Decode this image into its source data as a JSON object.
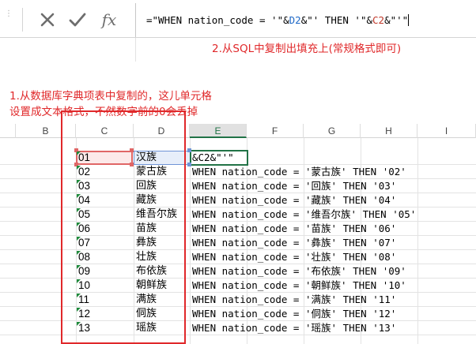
{
  "formula_bar": {
    "dots": "⋮",
    "cancel_icon": "x-icon",
    "enter_icon": "check-icon",
    "fx_label": "fx",
    "formula_prefix": "=\"WHEN nation_code = '\"&",
    "ref1": "D2",
    "formula_mid": "&\"' THEN '\"&",
    "ref2": "C2",
    "formula_suffix": "&\"'\""
  },
  "annotations": {
    "note2": "2.从SQL中复制出填充上(常规格式即可)",
    "note1_line1": "1.从数据库字典项表中复制的，这儿单元格",
    "note1_line2": "设置成文本格式，不然数字前的0会丢掉"
  },
  "columns": [
    "B",
    "C",
    "D",
    "E",
    "F",
    "G",
    "H",
    "I"
  ],
  "selected_column": "E",
  "rows": [
    {
      "c": "01",
      "d": "汉族",
      "e": "&C2&\"'\""
    },
    {
      "c": "02",
      "d": "蒙古族",
      "e": "WHEN nation_code = '蒙古族' THEN '02'"
    },
    {
      "c": "03",
      "d": "回族",
      "e": "WHEN nation_code = '回族' THEN '03'"
    },
    {
      "c": "04",
      "d": "藏族",
      "e": "WHEN nation_code = '藏族' THEN '04'"
    },
    {
      "c": "05",
      "d": "维吾尔族",
      "e": "WHEN nation_code = '维吾尔族' THEN '05'"
    },
    {
      "c": "06",
      "d": "苗族",
      "e": "WHEN nation_code = '苗族' THEN '06'"
    },
    {
      "c": "07",
      "d": "彝族",
      "e": "WHEN nation_code = '彝族' THEN '07'"
    },
    {
      "c": "08",
      "d": "壮族",
      "e": "WHEN nation_code = '壮族' THEN '08'"
    },
    {
      "c": "09",
      "d": "布依族",
      "e": "WHEN nation_code = '布依族' THEN '09'"
    },
    {
      "c": "10",
      "d": "朝鲜族",
      "e": "WHEN nation_code = '朝鲜族' THEN '10'"
    },
    {
      "c": "11",
      "d": "满族",
      "e": "WHEN nation_code = '满族' THEN '11'"
    },
    {
      "c": "12",
      "d": "侗族",
      "e": "WHEN nation_code = '侗族' THEN '12'"
    },
    {
      "c": "13",
      "d": "瑶族",
      "e": "WHEN nation_code = '瑶族' THEN '13'"
    }
  ],
  "colors": {
    "annotation_red": "#e0282a",
    "excel_green": "#217346",
    "ref_blue": "#1f69c7",
    "ref_red": "#c0392b"
  }
}
